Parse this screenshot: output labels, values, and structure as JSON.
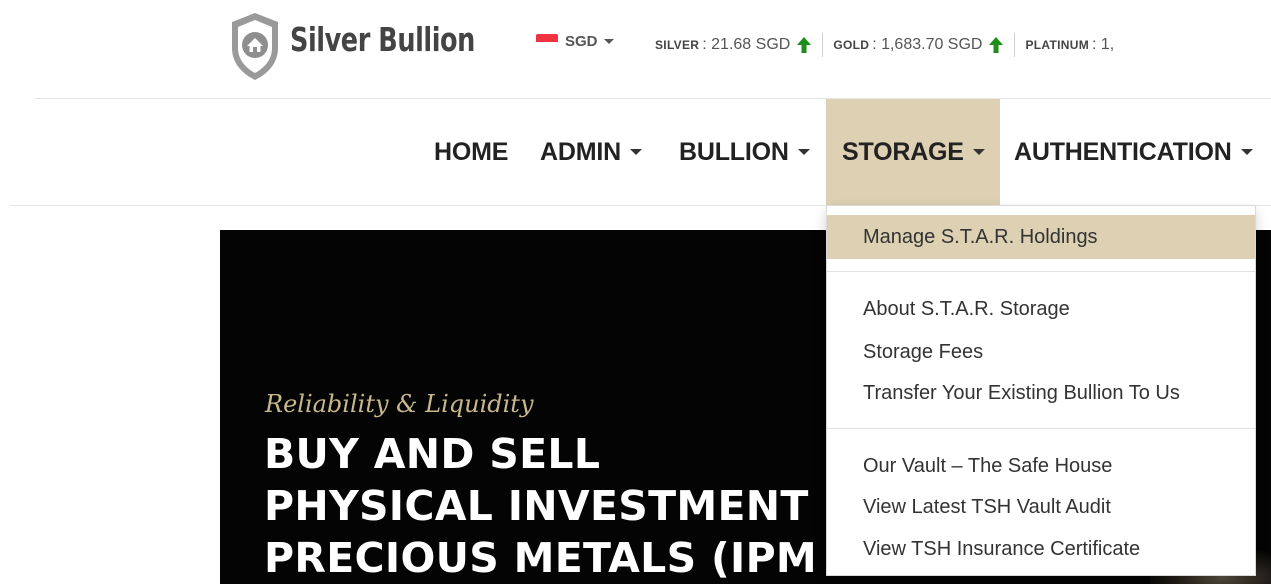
{
  "brand": {
    "name": "Silver Bullion"
  },
  "currency": {
    "code": "SGD",
    "flag": "singapore-flag"
  },
  "ticker": [
    {
      "metal": "SILVER",
      "price": ": 21.68 SGD",
      "trend": "up",
      "trend_color": "#1a8f1a"
    },
    {
      "metal": "GOLD",
      "price": ": 1,683.70 SGD",
      "trend": "up",
      "trend_color": "#1a8f1a"
    },
    {
      "metal": "PLATINUM",
      "price": ": 1,",
      "trend": null
    }
  ],
  "nav": {
    "home": "HOME",
    "admin": "ADMIN",
    "bullion": "BULLION",
    "storage": "STORAGE",
    "authentication": "AUTHENTICATION"
  },
  "dropdown": {
    "groups": [
      [
        "Manage S.T.A.R. Holdings"
      ],
      [
        "About S.T.A.R. Storage",
        "Storage Fees",
        "Transfer Your Existing Bullion To Us"
      ],
      [
        "Our Vault – The Safe House",
        "View Latest TSH Vault Audit",
        "View TSH Insurance Certificate"
      ]
    ],
    "active_item": "Manage S.T.A.R. Holdings"
  },
  "hero": {
    "tagline": "Reliability & Liquidity",
    "title_lines": [
      "BUY AND SELL",
      "PHYSICAL INVESTMENT",
      "PRECIOUS METALS (IPM"
    ]
  },
  "colors": {
    "accent": "#ddd0b3",
    "hero_bg": "#040404",
    "tagline": "#c9b88e",
    "up_arrow": "#1a8f1a"
  }
}
